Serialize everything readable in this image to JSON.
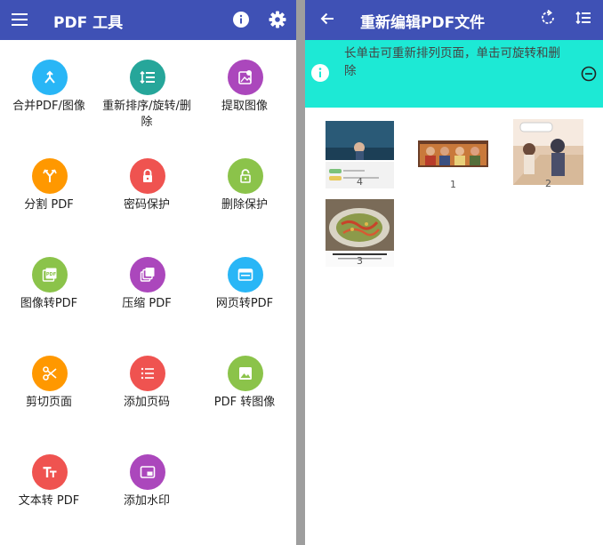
{
  "left": {
    "title": "PDF 工具",
    "items": [
      {
        "label": "合并PDF/图像",
        "color": "#29b6f6",
        "icon": "merge-icon"
      },
      {
        "label": "重新排序/旋转/删除",
        "color": "#26a69a",
        "icon": "reorder-icon"
      },
      {
        "label": "提取图像",
        "color": "#ab47bc",
        "icon": "extract-image-icon"
      },
      {
        "label": "分割 PDF",
        "color": "#ff9800",
        "icon": "split-icon"
      },
      {
        "label": "密码保护",
        "color": "#ef5350",
        "icon": "lock-icon"
      },
      {
        "label": "删除保护",
        "color": "#8bc34a",
        "icon": "unlock-icon"
      },
      {
        "label": "图像转PDF",
        "color": "#8bc34a",
        "icon": "pdf-file-icon"
      },
      {
        "label": "压缩 PDF",
        "color": "#ab47bc",
        "icon": "compress-icon"
      },
      {
        "label": "网页转PDF",
        "color": "#29b6f6",
        "icon": "web-page-icon"
      },
      {
        "label": "剪切页面",
        "color": "#ff9800",
        "icon": "scissors-icon"
      },
      {
        "label": "添加页码",
        "color": "#ef5350",
        "icon": "numbered-list-icon"
      },
      {
        "label": "PDF 转图像",
        "color": "#8bc34a",
        "icon": "image-icon"
      },
      {
        "label": "文本转 PDF",
        "color": "#ef5350",
        "icon": "text-icon"
      },
      {
        "label": "添加水印",
        "color": "#ab47bc",
        "icon": "watermark-icon"
      }
    ]
  },
  "right": {
    "title": "重新编辑PDF文件",
    "banner": "长单击可重新排列页面，单击可旋转和删除",
    "pages": [
      {
        "number": "4"
      },
      {
        "number": "1"
      },
      {
        "number": "2"
      },
      {
        "number": "3"
      }
    ]
  },
  "colors": {
    "appbar": "#3f51b5",
    "banner": "#1de9d5"
  }
}
